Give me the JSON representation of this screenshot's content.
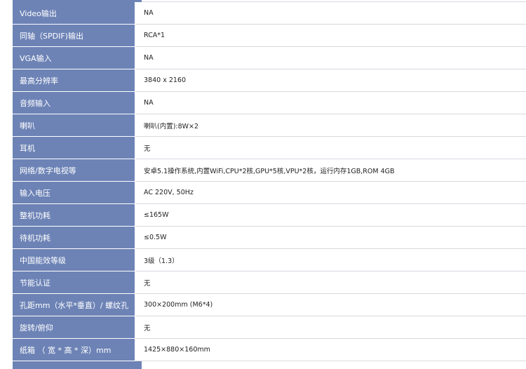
{
  "specs": [
    {
      "label": "Video输出",
      "value": "NA"
    },
    {
      "label": "同轴（SPDIF)输出",
      "value": "RCA*1"
    },
    {
      "label": "VGA输入",
      "value": "NA"
    },
    {
      "label": "最高分辨率",
      "value": "3840 x 2160"
    },
    {
      "label": "音频输入",
      "value": "NA"
    },
    {
      "label": "喇叭",
      "value": "喇叭(内置):8W×2"
    },
    {
      "label": "耳机",
      "value": "无"
    },
    {
      "label": "网络/数字电视等",
      "value": "安卓5.1操作系统,内置WiFi,CPU*2核,GPU*5核,VPU*2核，运行内存1GB,ROM 4GB"
    },
    {
      "label": "输入电压",
      "value": "AC 220V, 50Hz"
    },
    {
      "label": "整机功耗",
      "value": "≤165W"
    },
    {
      "label": "待机功耗",
      "value": "≤0.5W"
    },
    {
      "label": "中国能效等级",
      "value": "3级（1.3）"
    },
    {
      "label": "节能认证",
      "value": "无"
    },
    {
      "label": "孔距mm（水平*垂直）/ 螺纹孔",
      "value": "300×200mm (M6*4)"
    },
    {
      "label": "旋转/俯仰",
      "value": "无"
    },
    {
      "label": "纸箱 （ 宽 * 高 * 深）mm",
      "value": "1425×880×160mm"
    }
  ]
}
